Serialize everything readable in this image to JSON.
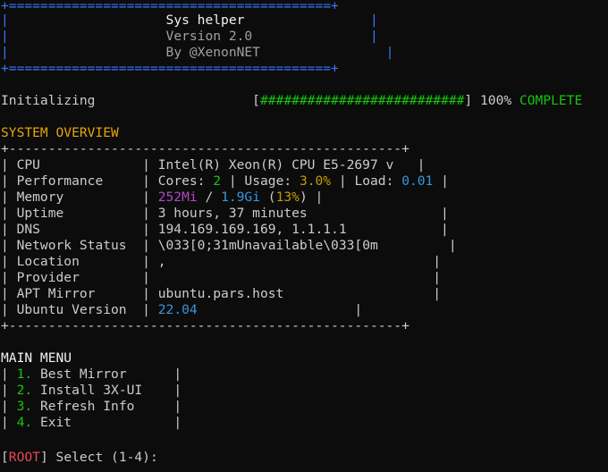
{
  "banner": {
    "border": "+=========================================+",
    "title": "Sys helper",
    "version": "Version 2.0",
    "author": "By @XenonNET"
  },
  "init": {
    "label": "Initializing",
    "bar": "[##########################]",
    "percent": "100%",
    "status": "COMPLETE",
    "progress": 1.0
  },
  "overview": {
    "heading": "SYSTEM OVERVIEW",
    "border": "+--------------------------------------------------+",
    "rows": [
      {
        "label": "CPU",
        "value": "Intel(R) Xeon(R) CPU E5-2697 v"
      },
      {
        "label": "Performance",
        "cores_label": "Cores:",
        "cores": "2",
        "usage_label": "Usage:",
        "usage": "3.0%",
        "load_label": "Load:",
        "load": "0.01"
      },
      {
        "label": "Memory",
        "used": "252Mi",
        "sep": "/",
        "total": "1.9Gi",
        "percent": "(13%)"
      },
      {
        "label": "Uptime",
        "value": "3 hours, 37 minutes"
      },
      {
        "label": "DNS",
        "value": "194.169.169.169, 1.1.1.1"
      },
      {
        "label": "Network Status",
        "value": "\\033[0;31mUnavailable\\033[0m"
      },
      {
        "label": "Location",
        "value": ","
      },
      {
        "label": "Provider",
        "value": ""
      },
      {
        "label": "APT Mirror",
        "value": "ubuntu.pars.host"
      },
      {
        "label": "Ubuntu Version",
        "value": "22.04"
      }
    ]
  },
  "menu": {
    "heading": "MAIN MENU",
    "items": [
      {
        "num": "1.",
        "label": "Best Mirror"
      },
      {
        "num": "2.",
        "label": "Install 3X-UI"
      },
      {
        "num": "3.",
        "label": "Refresh Info"
      },
      {
        "num": "4.",
        "label": "Exit"
      }
    ]
  },
  "prompt": {
    "user": "ROOT",
    "text": "Select (1-4):"
  },
  "colors": {
    "background": "#0c0c0c",
    "foreground": "#cccccc",
    "border_blue": "#3b78ff",
    "green": "#16c60c",
    "yellow": "#c19c00",
    "cyan": "#3a96dd",
    "red": "#e74856"
  }
}
